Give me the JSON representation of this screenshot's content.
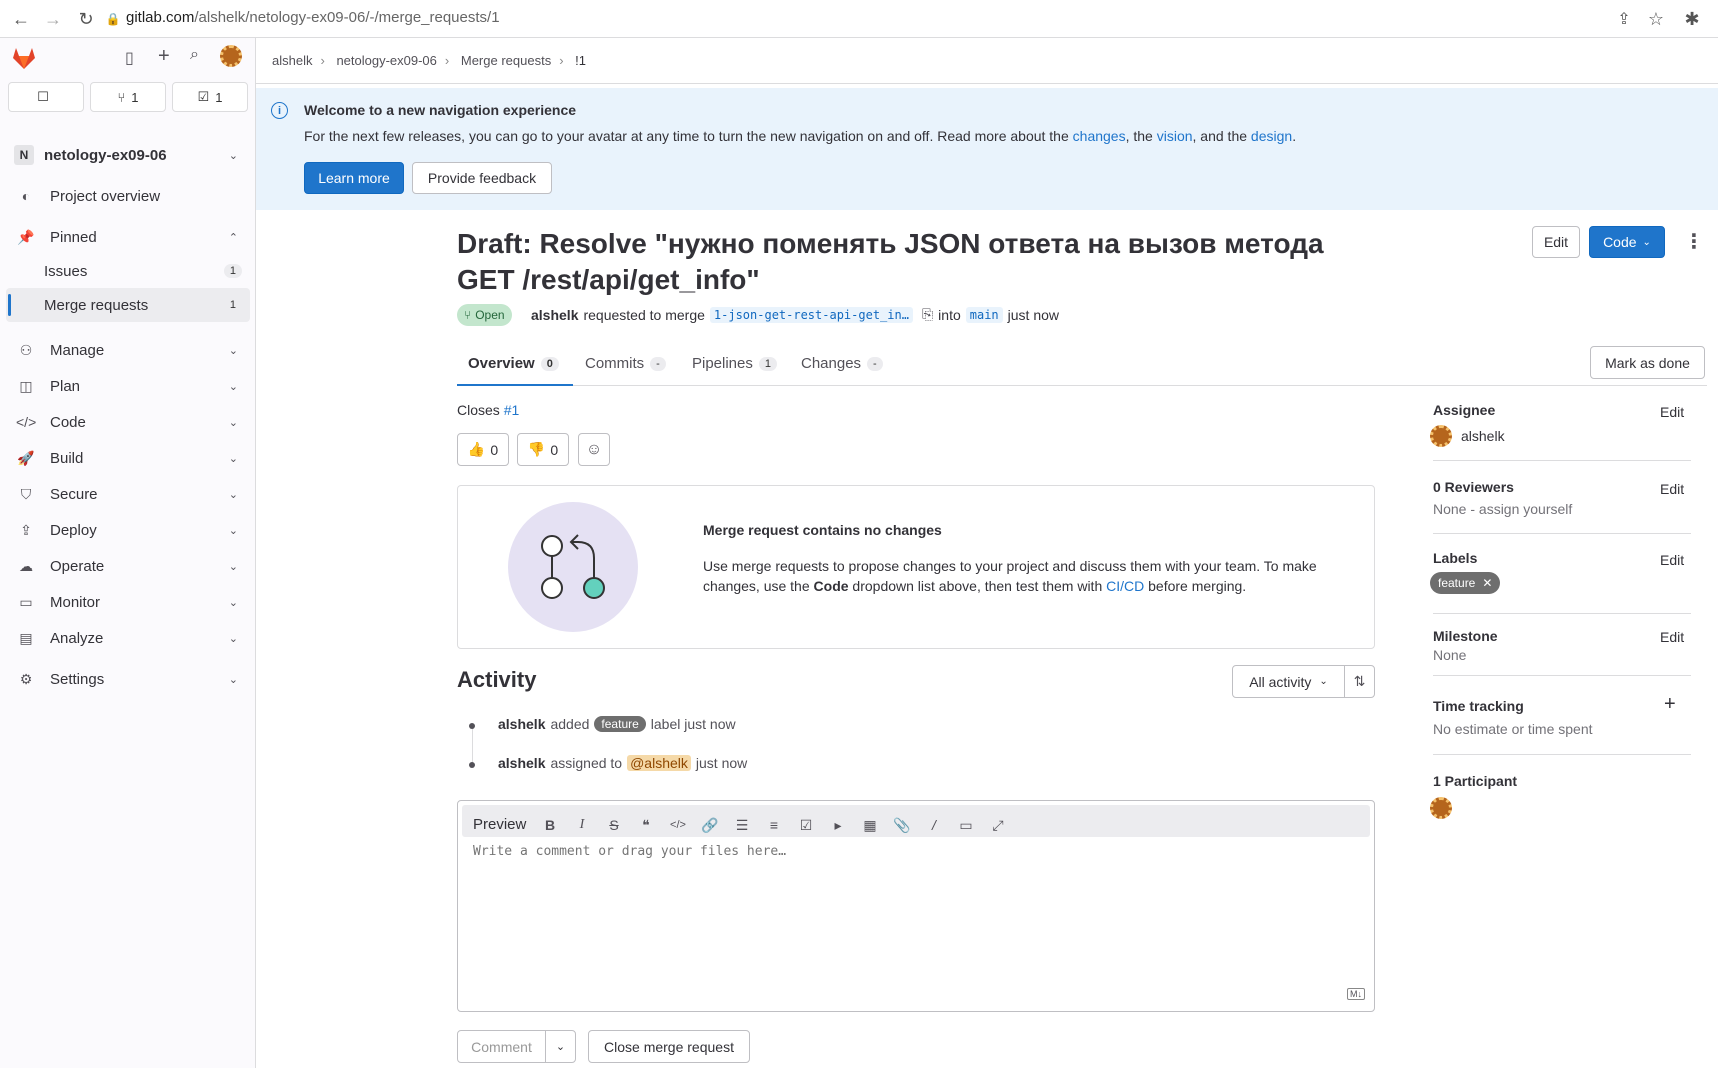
{
  "browser": {
    "url_host": "gitlab.com",
    "url_path": "/alshelk/netology-ex09-06/-/merge_requests/1"
  },
  "sidebar": {
    "counters": [
      {
        "icon": "issues-icon",
        "value": ""
      },
      {
        "icon": "merge-request-icon",
        "value": "1"
      },
      {
        "icon": "todo-icon",
        "value": "1"
      }
    ],
    "project_initial": "N",
    "project_name": "netology-ex09-06",
    "items": [
      {
        "label": "Project overview",
        "icon": "project-icon"
      },
      {
        "label": "Pinned",
        "icon": "pin-icon"
      },
      {
        "label": "Issues",
        "count": "1"
      },
      {
        "label": "Merge requests",
        "count": "1"
      },
      {
        "label": "Manage",
        "icon": "users-icon"
      },
      {
        "label": "Plan",
        "icon": "plan-icon"
      },
      {
        "label": "Code",
        "icon": "code-icon"
      },
      {
        "label": "Build",
        "icon": "rocket-icon"
      },
      {
        "label": "Secure",
        "icon": "shield-icon"
      },
      {
        "label": "Deploy",
        "icon": "deploy-icon"
      },
      {
        "label": "Operate",
        "icon": "cloud-icon"
      },
      {
        "label": "Monitor",
        "icon": "monitor-icon"
      },
      {
        "label": "Analyze",
        "icon": "chart-icon"
      },
      {
        "label": "Settings",
        "icon": "gear-icon"
      }
    ]
  },
  "breadcrumb": [
    "alshelk",
    "netology-ex09-06",
    "Merge requests",
    "!1"
  ],
  "banner": {
    "title": "Welcome to a new navigation experience",
    "text_before": "For the next few releases, you can go to your avatar at any time to turn the new navigation on and off. Read more about the ",
    "link1": "changes",
    "text_mid1": ", the ",
    "link2": "vision",
    "text_mid2": ", and the ",
    "link3": "design",
    "text_end": ".",
    "learn_more": "Learn more",
    "feedback": "Provide feedback"
  },
  "mr": {
    "title": "Draft: Resolve \"нужно поменять JSON ответа на вызов метода GET /rest/api/get_info\"",
    "edit": "Edit",
    "code": "Code",
    "status": "Open",
    "author": "alshelk",
    "requested": "requested to merge",
    "source_branch": "1-json-get-rest-api-get_in…",
    "into": "into",
    "target_branch": "main",
    "time": "just now"
  },
  "tabs": [
    {
      "label": "Overview",
      "count": "0"
    },
    {
      "label": "Commits",
      "count": "-"
    },
    {
      "label": "Pipelines",
      "count": "1"
    },
    {
      "label": "Changes",
      "count": "-"
    }
  ],
  "mark_done": "Mark as done",
  "closes": {
    "label": "Closes",
    "ref": "#1"
  },
  "reactions": {
    "thumbsup": "0",
    "thumbsdown": "0"
  },
  "empty_state": {
    "title": "Merge request contains no changes",
    "text1": "Use merge requests to propose changes to your project and discuss them with your team. To make changes, use the ",
    "bold": "Code",
    "text2": " dropdown list above, then test them with ",
    "link": "CI/CD",
    "text3": " before merging."
  },
  "activity": {
    "title": "Activity",
    "filter": "All activity",
    "items": [
      {
        "user": "alshelk",
        "pre": "added",
        "label": "feature",
        "post": "label just now"
      },
      {
        "user": "alshelk",
        "pre": "assigned to",
        "mention": "@alshelk",
        "post": "just now"
      }
    ]
  },
  "editor": {
    "preview": "Preview",
    "placeholder": "Write a comment or drag your files here…",
    "md_badge": "M↓"
  },
  "footer": {
    "comment": "Comment",
    "close": "Close merge request"
  },
  "sidebar_right": {
    "assignee_title": "Assignee",
    "assignee": "alshelk",
    "reviewers_title": "0 Reviewers",
    "reviewers_value": "None - assign yourself",
    "labels_title": "Labels",
    "label": "feature",
    "milestone_title": "Milestone",
    "milestone_value": "None",
    "time_title": "Time tracking",
    "time_value": "No estimate or time spent",
    "participants_title": "1 Participant",
    "edit": "Edit"
  },
  "colors": {
    "accent": "#1f75cb",
    "status_open": "#108548",
    "label_feature": "#6e6e6e"
  }
}
